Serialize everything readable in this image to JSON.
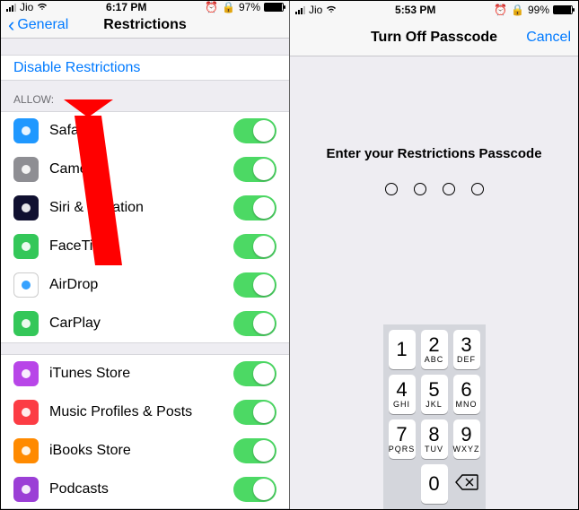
{
  "left": {
    "status": {
      "carrier": "Jio",
      "time": "6:17 PM",
      "battery": "97%"
    },
    "nav": {
      "back": "General",
      "title": "Restrictions"
    },
    "disable_link": "Disable Restrictions",
    "allow_header": "ALLOW:",
    "group1": [
      {
        "label": "Safari",
        "color": "#1f98ff"
      },
      {
        "label": "Camera",
        "color": "#8e8e93"
      },
      {
        "label": "Siri & Dictation",
        "color": "#101030"
      },
      {
        "label": "FaceTime",
        "color": "#34c759"
      },
      {
        "label": "AirDrop",
        "color": "#ffffff"
      },
      {
        "label": "CarPlay",
        "color": "#34c759"
      }
    ],
    "group2": [
      {
        "label": "iTunes Store",
        "color": "#b846e8"
      },
      {
        "label": "Music Profiles & Posts",
        "color": "#fc3c44"
      },
      {
        "label": "iBooks Store",
        "color": "#ff8a00"
      },
      {
        "label": "Podcasts",
        "color": "#9b3fd6"
      }
    ]
  },
  "right": {
    "status": {
      "carrier": "Jio",
      "time": "5:53 PM",
      "battery": "99%"
    },
    "nav": {
      "title": "Turn Off Passcode",
      "cancel": "Cancel"
    },
    "prompt": "Enter your Restrictions Passcode",
    "keys": [
      {
        "n": "1",
        "sub": ""
      },
      {
        "n": "2",
        "sub": "ABC"
      },
      {
        "n": "3",
        "sub": "DEF"
      },
      {
        "n": "4",
        "sub": "GHI"
      },
      {
        "n": "5",
        "sub": "JKL"
      },
      {
        "n": "6",
        "sub": "MNO"
      },
      {
        "n": "7",
        "sub": "PQRS"
      },
      {
        "n": "8",
        "sub": "TUV"
      },
      {
        "n": "9",
        "sub": "WXYZ"
      },
      {
        "n": "0",
        "sub": ""
      }
    ]
  }
}
